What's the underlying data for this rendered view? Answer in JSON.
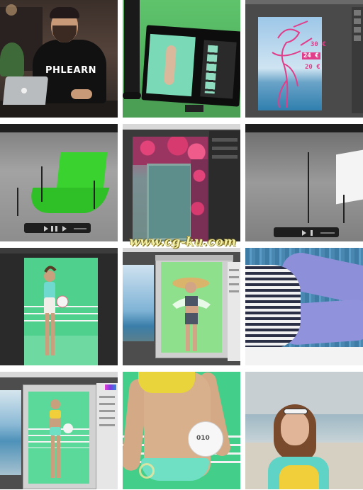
{
  "gallery": {
    "tiles": [
      {
        "id": "presenter",
        "shirt_text": "PHLEARN"
      },
      {
        "id": "monitor-green-screen"
      },
      {
        "id": "sketch-over-sky",
        "price_labels": [
          "30 €",
          "24 €",
          "20 €"
        ]
      },
      {
        "id": "studio-green-backdrop-render"
      },
      {
        "id": "flowers-door-edit"
      },
      {
        "id": "studio-lights-render"
      },
      {
        "id": "model-on-green-screen"
      },
      {
        "id": "photoshop-hat-model"
      },
      {
        "id": "legs-close-up"
      },
      {
        "id": "photoshop-green-model"
      },
      {
        "id": "torso-with-ball",
        "ball_text": "010"
      },
      {
        "id": "beach-portrait"
      }
    ]
  },
  "overlays": {
    "watermark": "www.cg-ku.com"
  },
  "colors": {
    "green_screen": "#4fd18d",
    "backdrop_green": "#39d22e",
    "sketch_pink": "#e23d8a",
    "watermark": "#f2f0a6"
  }
}
